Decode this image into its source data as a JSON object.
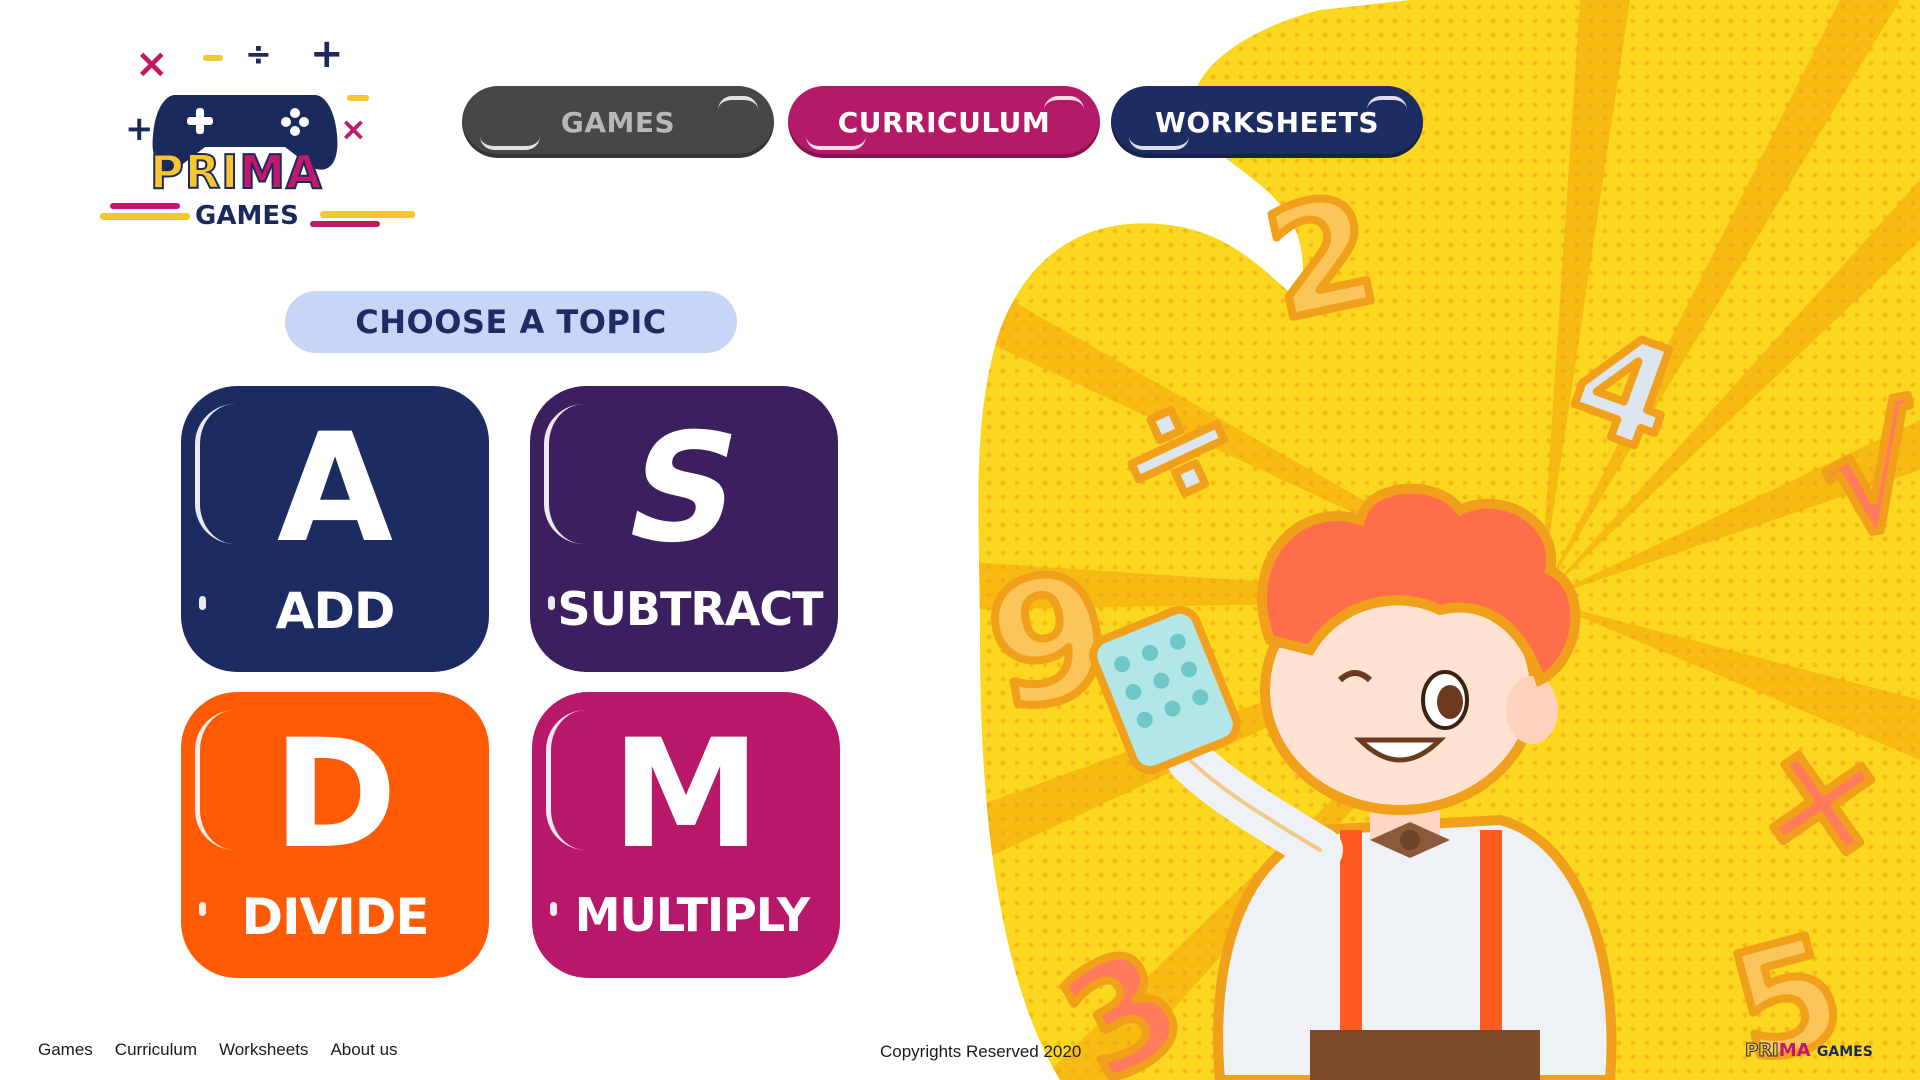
{
  "brand": {
    "logo_pri": "PRI",
    "logo_ma": "MA",
    "logo_games": "GAMES",
    "colors": {
      "yellow": "#f7c531",
      "magenta": "#c2186b",
      "navy": "#1b2a5c",
      "orange": "#ff5b07",
      "purple": "#3c1f5f"
    }
  },
  "nav": [
    {
      "label": "GAMES",
      "color": "#474747"
    },
    {
      "label": "CURRICULUM",
      "color": "#b51a68"
    },
    {
      "label": "WORKSHEETS",
      "color": "#1d2d63"
    }
  ],
  "main": {
    "heading": "CHOOSE A TOPIC",
    "topics": [
      {
        "letter": "A",
        "label": "ADD",
        "color": "#1c2c61"
      },
      {
        "letter": "S",
        "label": "SUBTRACT",
        "color": "#3c1f5f"
      },
      {
        "letter": "D",
        "label": "DIVIDE",
        "color": "#ff5b07"
      },
      {
        "letter": "M",
        "label": "MULTIPLY",
        "color": "#b8186a"
      }
    ]
  },
  "footer": {
    "links": [
      "Games",
      "Curriculum",
      "Worksheets",
      "About us"
    ],
    "copyright": "Copyrights Reserved 2020",
    "logo_pri": "PRI",
    "logo_ma": "MA",
    "logo_games": "GAMES"
  },
  "illustration": {
    "numbers": [
      "2",
      "4",
      "9",
      "3",
      "5"
    ],
    "symbols": [
      "÷",
      "√",
      "×"
    ],
    "icons": [
      "calculator-icon",
      "boy-character",
      "bow-tie"
    ]
  }
}
